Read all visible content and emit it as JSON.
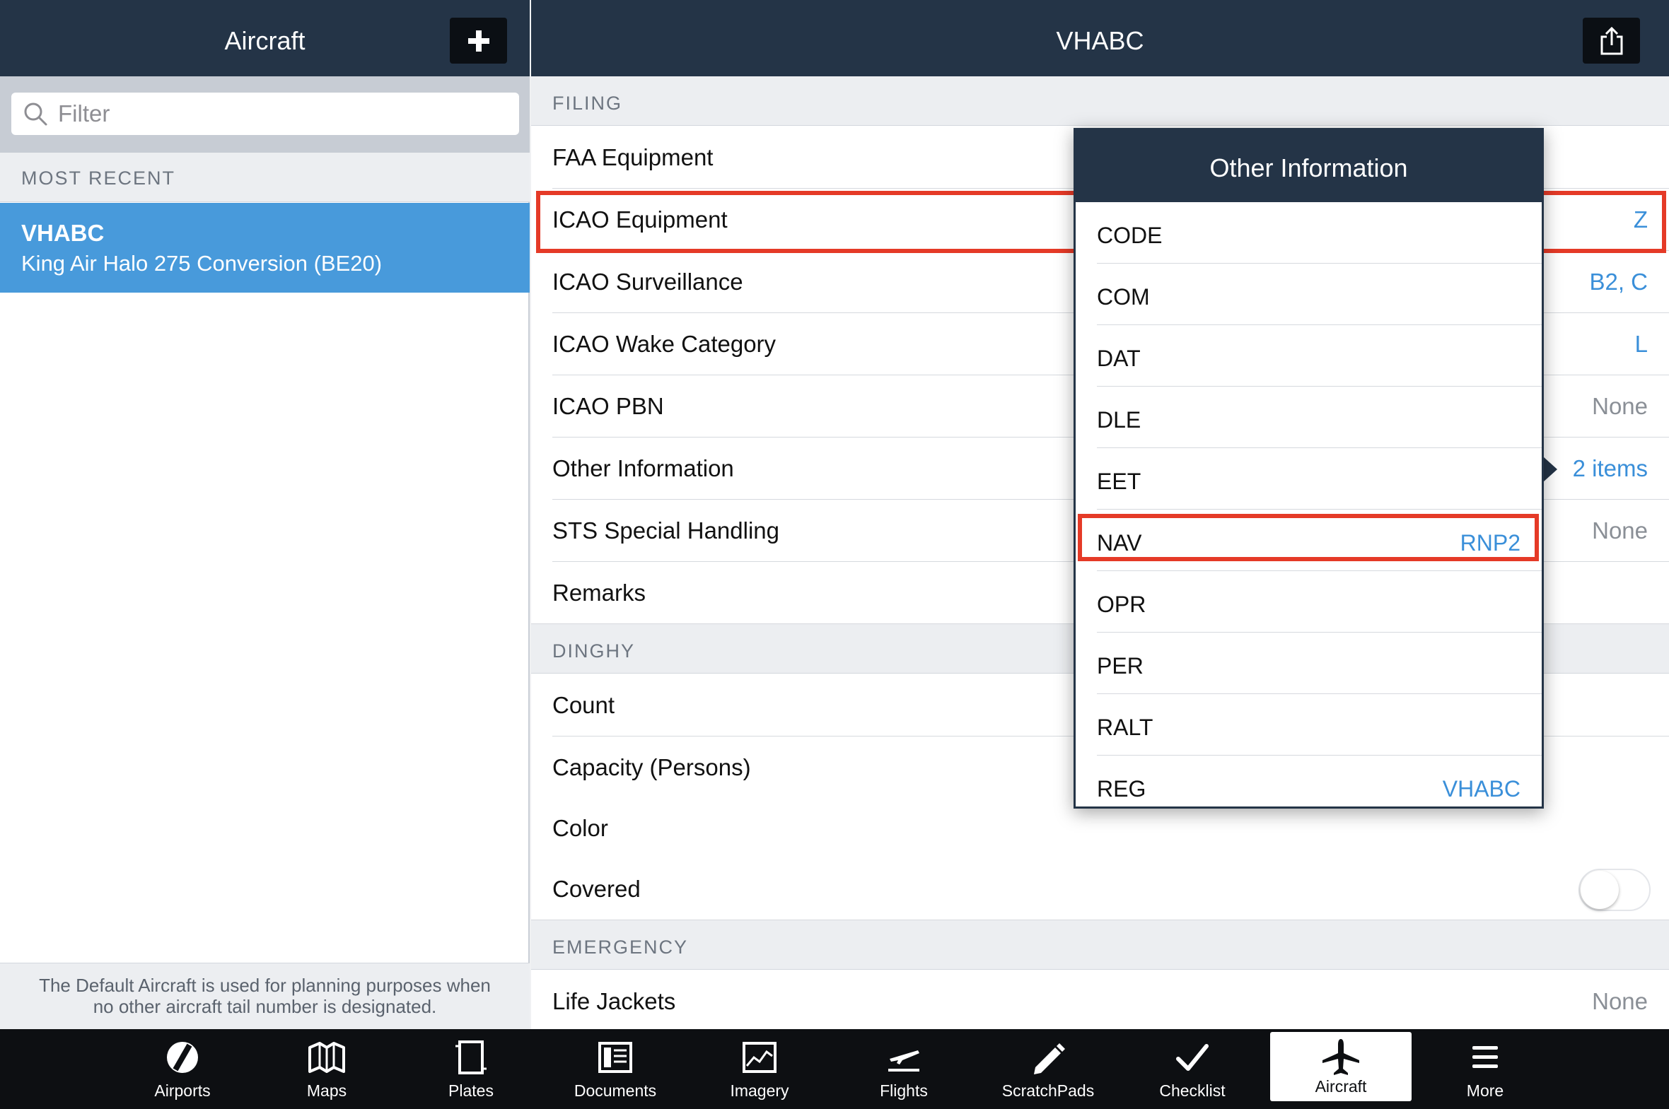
{
  "left_panel": {
    "title": "Aircraft",
    "search_placeholder": "Filter",
    "section_header": "MOST RECENT",
    "recent": {
      "tail": "VHABC",
      "description": "King Air Halo 275 Conversion (BE20)"
    },
    "footer_line1": "The Default Aircraft is used for planning purposes when",
    "footer_line2": "no other aircraft tail number is designated."
  },
  "right_panel": {
    "title": "VHABC",
    "sections": {
      "filing": "FILING",
      "dinghy": "DINGHY",
      "emergency": "EMERGENCY"
    },
    "filing_rows": [
      {
        "label": "FAA Equipment",
        "value": ""
      },
      {
        "label": "ICAO Equipment",
        "value": "Z"
      },
      {
        "label": "ICAO Surveillance",
        "value": "B2, C"
      },
      {
        "label": "ICAO Wake Category",
        "value": "L"
      },
      {
        "label": "ICAO PBN",
        "value": "None"
      },
      {
        "label": "Other Information",
        "value": "2 items"
      },
      {
        "label": "STS Special Handling",
        "value": "None"
      },
      {
        "label": "Remarks",
        "value": ""
      }
    ],
    "dinghy_rows": [
      {
        "label": "Count",
        "value": ""
      },
      {
        "label": "Capacity (Persons)",
        "value": ""
      },
      {
        "label": "Color",
        "value": ""
      },
      {
        "label": "Covered",
        "value": "",
        "toggle_on": false
      }
    ],
    "emergency_rows": [
      {
        "label": "Life Jackets",
        "value": "None"
      }
    ]
  },
  "popover": {
    "title": "Other Information",
    "items": [
      {
        "code": "CODE",
        "value": ""
      },
      {
        "code": "COM",
        "value": ""
      },
      {
        "code": "DAT",
        "value": ""
      },
      {
        "code": "DLE",
        "value": ""
      },
      {
        "code": "EET",
        "value": ""
      },
      {
        "code": "NAV",
        "value": "RNP2"
      },
      {
        "code": "OPR",
        "value": ""
      },
      {
        "code": "PER",
        "value": ""
      },
      {
        "code": "RALT",
        "value": ""
      },
      {
        "code": "REG",
        "value": "VHABC"
      }
    ]
  },
  "tabbar": {
    "tabs": [
      {
        "label": "Airports",
        "icon": "airports-icon"
      },
      {
        "label": "Maps",
        "icon": "maps-icon"
      },
      {
        "label": "Plates",
        "icon": "plates-icon"
      },
      {
        "label": "Documents",
        "icon": "documents-icon"
      },
      {
        "label": "Imagery",
        "icon": "imagery-icon"
      },
      {
        "label": "Flights",
        "icon": "flights-icon"
      },
      {
        "label": "ScratchPads",
        "icon": "scratchpads-icon"
      },
      {
        "label": "Checklist",
        "icon": "checklist-icon"
      },
      {
        "label": "Aircraft",
        "icon": "aircraft-icon",
        "active": true
      },
      {
        "label": "More",
        "icon": "more-icon"
      }
    ]
  },
  "colors": {
    "navbar": "#243447",
    "selected_row": "#489adb",
    "accent_blue": "#3a8fd9",
    "highlight_red": "#e53a27",
    "tabbar": "#0d0f12"
  }
}
